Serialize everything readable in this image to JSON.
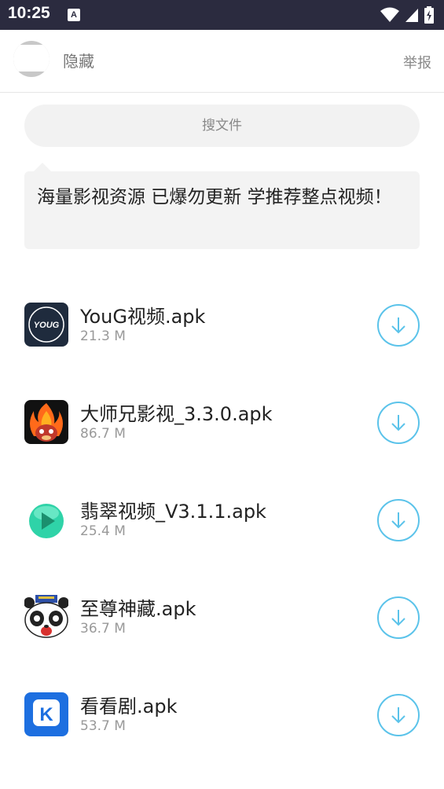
{
  "status_bar": {
    "time": "10:25",
    "notification_icon_letter": "A",
    "icons": [
      "wifi-icon",
      "signal-icon",
      "battery-charging-icon"
    ]
  },
  "header": {
    "title": "隐藏",
    "report": "举报"
  },
  "search": {
    "placeholder": "搜文件"
  },
  "message": {
    "text": "海量影视资源 已爆勿更新 学推荐整点视频！"
  },
  "files": [
    {
      "name": "YouG视频.apk",
      "size": "21.3 M",
      "icon": "youg-app-icon",
      "icon_text": "YOUG"
    },
    {
      "name": "大师兄影视_3.3.0.apk",
      "size": "86.7 M",
      "icon": "dashixiong-app-icon"
    },
    {
      "name": "翡翠视频_V3.1.1.apk",
      "size": "25.4 M",
      "icon": "feicui-play-app-icon"
    },
    {
      "name": "至尊神藏.apk",
      "size": "36.7 M",
      "icon": "panda-app-icon"
    },
    {
      "name": "看看剧.apk",
      "size": "53.7 M",
      "icon": "kankanju-app-icon",
      "icon_text": "K"
    }
  ],
  "colors": {
    "status_bar": "#2b2b3f",
    "accent": "#5bc3ea",
    "muted_text": "#999999"
  }
}
